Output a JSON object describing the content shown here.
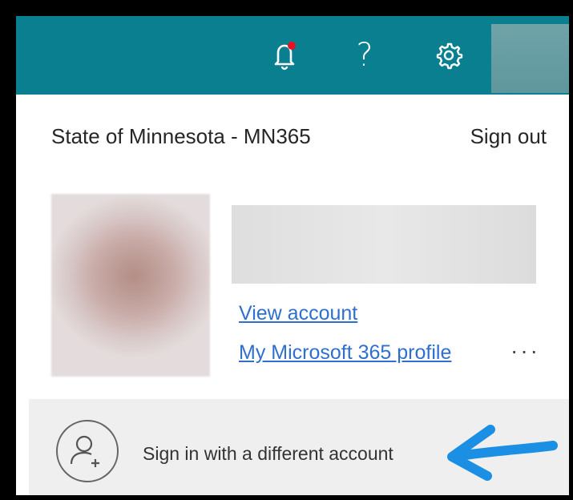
{
  "header": {
    "icons": {
      "bell": "bell-notification-icon",
      "help": "help-icon",
      "settings": "gear-icon",
      "avatar": "user-avatar"
    },
    "help_glyph": "?",
    "colors": {
      "bar": "#0a7f8f",
      "notification_dot": "#e81123"
    }
  },
  "account": {
    "organization": "State of Minnesota - MN365",
    "sign_out_label": "Sign out",
    "view_account_label": "View account",
    "profile_link_label": "My Microsoft 365 profile",
    "more_options_label": "···",
    "link_color": "#2f6fcf"
  },
  "footer": {
    "different_account_label": "Sign in with a different account",
    "add_person_icon": "person-add-icon",
    "annotation_arrow_color": "#1a8fe3"
  }
}
